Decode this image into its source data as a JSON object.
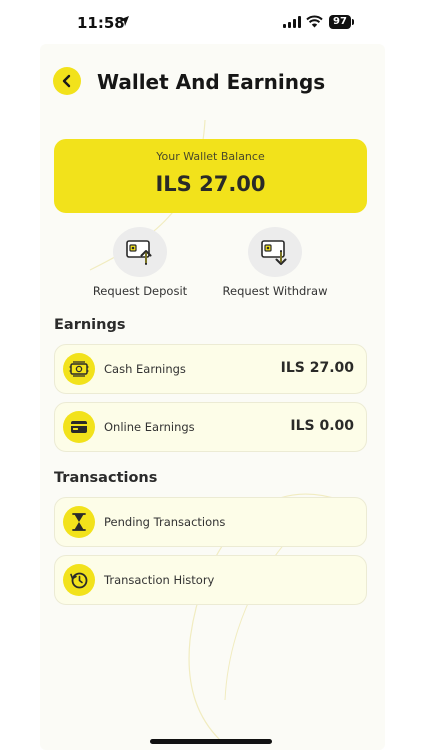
{
  "status_bar": {
    "time": "11:58",
    "battery": "97"
  },
  "header": {
    "title": "Wallet And Earnings"
  },
  "balance": {
    "label": "Your Wallet Balance",
    "value": "ILS 27.00"
  },
  "actions": [
    {
      "label": "Request Deposit",
      "icon": "wallet-deposit-icon"
    },
    {
      "label": "Request Withdraw",
      "icon": "wallet-withdraw-icon"
    }
  ],
  "earnings": {
    "title": "Earnings",
    "items": [
      {
        "label": "Cash Earnings",
        "amount": "ILS 27.00",
        "icon": "cash-icon"
      },
      {
        "label": "Online Earnings",
        "amount": "ILS 0.00",
        "icon": "card-icon"
      }
    ]
  },
  "transactions": {
    "title": "Transactions",
    "items": [
      {
        "label": "Pending Transactions",
        "icon": "hourglass-icon"
      },
      {
        "label": "Transaction History",
        "icon": "history-icon"
      }
    ]
  },
  "colors": {
    "accent": "#f2e21b",
    "card_bg": "#fdfde8",
    "text": "#161616"
  }
}
